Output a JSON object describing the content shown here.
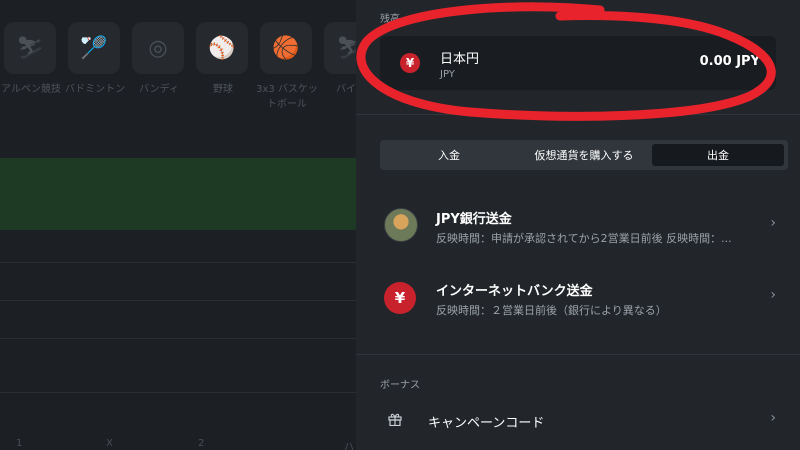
{
  "background": {
    "sports": [
      {
        "icon": "skier-icon",
        "label": "アルペン競技"
      },
      {
        "icon": "badminton-icon",
        "label": "バドミントン"
      },
      {
        "icon": "bandy-icon",
        "label": "バンディ"
      },
      {
        "icon": "baseball-icon",
        "label": "野球"
      },
      {
        "icon": "basketball-icon",
        "label": "3x3 バスケットボール"
      },
      {
        "icon": "biathlon-icon",
        "label": "バイア"
      }
    ],
    "footer_markers": [
      "1",
      "X",
      "2",
      "ハ"
    ]
  },
  "panel": {
    "balance_label": "残高",
    "balance": {
      "icon": "yen-icon",
      "name": "日本円",
      "code": "JPY",
      "amount": "0.00 JPY"
    },
    "tabs": [
      {
        "label": "入金",
        "active": false
      },
      {
        "label": "仮想通貨を購入する",
        "active": false
      },
      {
        "label": "出金",
        "active": true
      }
    ],
    "methods": [
      {
        "icon": "bank-avatar-icon",
        "title": "JPY銀行送金",
        "desc": "反映時間：申請が承認されてから2営業日前後 反映時間：..."
      },
      {
        "icon": "yen-icon",
        "title": "インターネットバンク送金",
        "desc": "反映時間：２営業日前後（銀行により異なる）"
      }
    ],
    "bonus_label": "ボーナス",
    "bonus_item": {
      "icon": "gift-icon",
      "label": "キャンペーンコード"
    }
  },
  "colors": {
    "annotation": "#e8232b",
    "yen_badge": "#c8232c",
    "panel_bg": "#22262b"
  }
}
